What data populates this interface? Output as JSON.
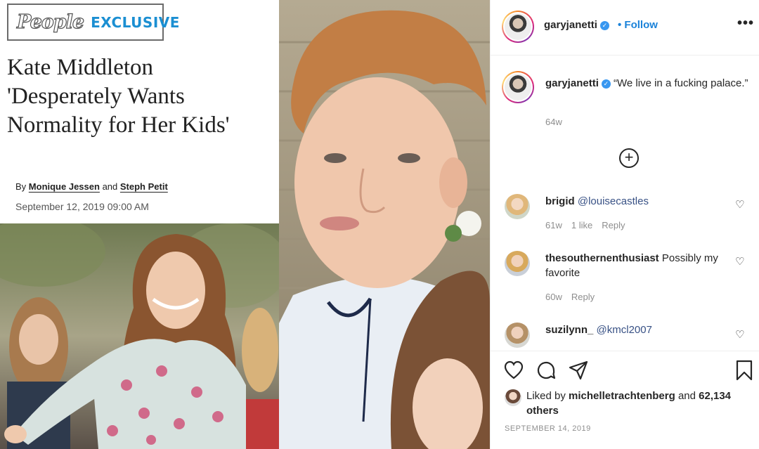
{
  "article": {
    "brand": "People",
    "exclusive": "EXCLUSIVE",
    "headline_1": "Kate Middleton",
    "headline_2": "'Desperately Wants",
    "headline_3": "Normality for Her Kids'",
    "by": "By",
    "author_1": "Monique Jessen",
    "and": "and",
    "author_2": "Steph Petit",
    "date": "September 12, 2019 09:00 AM"
  },
  "post": {
    "username": "garyjanetti",
    "follow_label": "Follow",
    "more_icon": "more-options-icon",
    "caption": "“We live in a fucking palace.”",
    "caption_age": "64w",
    "load_more_icon": "plus-circle-icon",
    "comments": [
      {
        "username": "brigid",
        "text": "@louisecastles",
        "age": "61w",
        "likes": "1 like",
        "reply": "Reply"
      },
      {
        "username": "thesouthernenthusiast",
        "text": "Possibly my favorite",
        "age": "60w",
        "reply": "Reply"
      },
      {
        "username": "suzilynn_",
        "text": "@kmcl2007"
      }
    ],
    "liked_by_prefix": "Liked by",
    "liked_by_user": "michelletrachtenberg",
    "liked_by_suffix": "and",
    "likes_count": "62,134 others",
    "date": "SEPTEMBER 14, 2019",
    "icons": [
      "heart-icon",
      "comment-icon",
      "share-icon",
      "bookmark-icon"
    ],
    "verified_color": "#3897f0",
    "link_color": "#1a82d9"
  }
}
